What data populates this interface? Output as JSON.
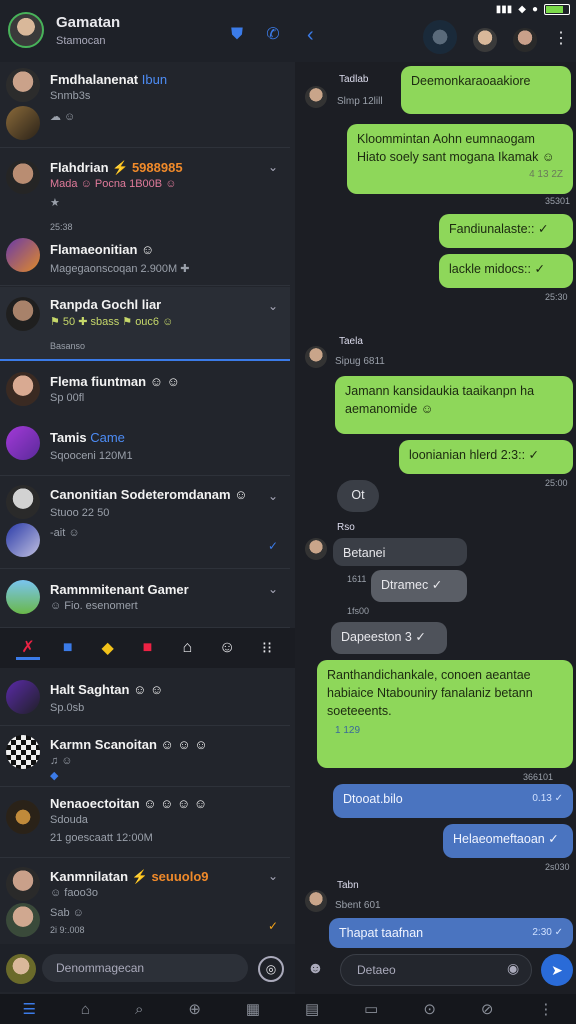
{
  "status": {
    "signal": "▮▮▮",
    "wifi": "◆",
    "bt": "●"
  },
  "left_header": {
    "title": "Gamatan",
    "subtitle": "Stamocan"
  },
  "chats": [
    {
      "name": "Fmdhalanenat",
      "tag": "Ibun",
      "line1": "Snmb3s",
      "line2": "☁ ☺"
    },
    {
      "name": "Flahdrian",
      "tag": "⚡ 5988985",
      "line1": "Mada ☺ Pocna 1B00B ☺",
      "line2": "★",
      "time": "25:38"
    },
    {
      "name": "Flamaeonitian",
      "tag": "☺",
      "line1": "Magegaonscoqan 2.900M ✚"
    },
    {
      "name": "Ranpda Gochl liar",
      "line1": "⚑ 50 ✚ sbass ⚑ ouc6 ☺",
      "time": "Basanso"
    },
    {
      "name": "Flema fiuntman",
      "tag": "☺ ☺",
      "line1": "Sp 00fl"
    },
    {
      "name": "Tamis",
      "tag": "Came",
      "line1": "Sqooceni 120M1"
    },
    {
      "name": "Canonitian Sodeteromdanam",
      "tag": "☺",
      "line1": "Stuoo 22 50",
      "line2": "-ait ☺"
    },
    {
      "name": "Rammmitenant Gamer",
      "line1": "☺ Fio. esenomert"
    },
    {
      "name": "Halt Saghtan",
      "tag": "☺ ☺",
      "line1": "Sp.0sb"
    },
    {
      "name": "Karmn Scanoitan",
      "tag": "☺ ☺ ☺",
      "line1": "♫ ☺",
      "line2": "◆"
    },
    {
      "name": "Nenaoectoitan",
      "tag": "☺ ☺ ☺ ☺",
      "line1": "Sdouda",
      "line2": "21 goescaatt 12:00M"
    },
    {
      "name": "Kanmnilatan",
      "tag": "⚡ seuuolo9",
      "line1": "☺ faoo3o",
      "line2": "Sab ☺",
      "line3": "2i 9:.008"
    }
  ],
  "tabs": [
    "✗",
    "■",
    "◆",
    "■",
    "⌂",
    "☺",
    "⁝⁝"
  ],
  "left_compose": {
    "placeholder": "Denommagecan"
  },
  "nav": [
    "☰",
    "⌂",
    "⌕",
    "⊕",
    "▦",
    "▤",
    "▭",
    "⊙",
    "⊘",
    "⋮"
  ],
  "messages": [
    {
      "sender": "Tadlab",
      "sub": "Slmp 12lill",
      "text": "Deemonkaraoaakiore"
    },
    {
      "text": "Kloommintan Aohn eumnaogam Hiato soely sant mogana Ikamak ☺",
      "time": "4 13 2Z",
      "stamp": "35301"
    },
    {
      "text": "Fandiunalaste:: ✓",
      "stamp": ""
    },
    {
      "text": "lackle midocs:: ✓",
      "stamp": "25:30"
    },
    {
      "sender": "Taela",
      "sub": "Sipug 6811"
    },
    {
      "text": "Jamann kansidaukia taaikanpn ha aemanomide ☺",
      "stamp": ""
    },
    {
      "text": "loonianian hlerd 2:3:: ✓",
      "stamp": "25:00"
    },
    {
      "text": "Ot"
    },
    {
      "sender": "Rso"
    },
    {
      "text": "Betanei"
    },
    {
      "text": "Dtramec ✓",
      "stamp": "1611"
    },
    {
      "text": "Dapeeston 3 ✓",
      "stamp": "1fs00"
    },
    {
      "text": "Ranthandichankale, conoen aeantae habiaice Ntabouniry fanalaniz betann soeteeents.",
      "link": "Ntabouniry fanalaniz betann",
      "time": "1 129",
      "stamp": "366101"
    },
    {
      "text": "Dtooat.bilo",
      "time": "0.13 ✓"
    },
    {
      "text": "Helaeomeftaoan ✓",
      "stamp": "2s030"
    },
    {
      "sender": "Tabn",
      "sub": "Sbent 601"
    },
    {
      "text": "Thapat taafnan",
      "time": "2:30 ✓"
    }
  ],
  "right_compose": {
    "placeholder": "Detaeo"
  }
}
